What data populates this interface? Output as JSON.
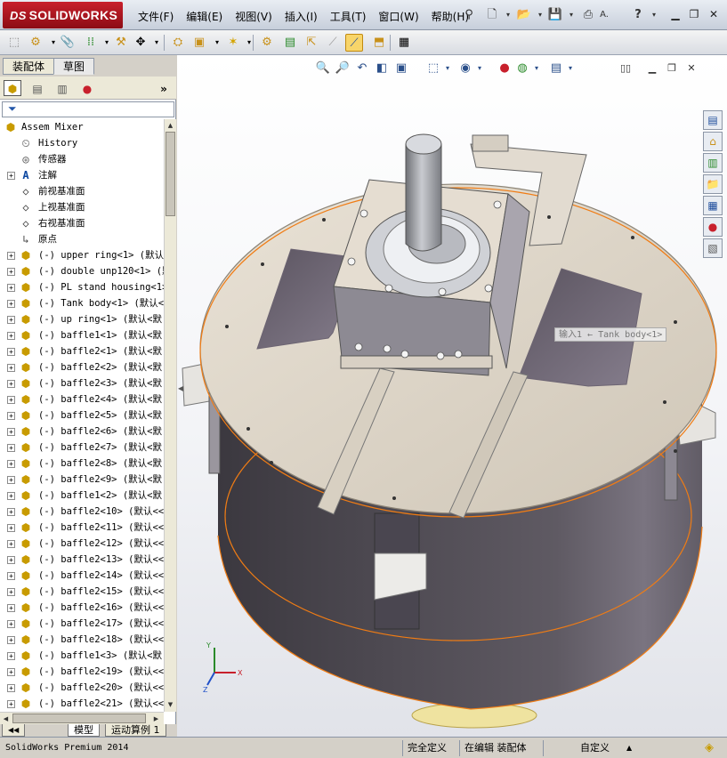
{
  "app": {
    "logo_prefix": "DS",
    "logo_text": "SOLIDWORKS"
  },
  "menu": [
    "文件(F)",
    "编辑(E)",
    "视图(V)",
    "插入(I)",
    "工具(T)",
    "窗口(W)",
    "帮助(H)"
  ],
  "title_extra": {
    "letters": "A.",
    "help": "?"
  },
  "panel": {
    "tabs": [
      "装配体",
      "草图"
    ],
    "active_tab": "装配体",
    "collapse_label": "»"
  },
  "tree": {
    "root": "Assem Mixer",
    "items": [
      {
        "label": "History",
        "icon": "history-icon",
        "type": "feature"
      },
      {
        "label": "传感器",
        "icon": "sensor-icon",
        "type": "feature"
      },
      {
        "label": "注解",
        "icon": "annotation-icon",
        "type": "feature",
        "expandable": true
      },
      {
        "label": "前视基准面",
        "icon": "plane-icon",
        "type": "plane"
      },
      {
        "label": "上视基准面",
        "icon": "plane-icon",
        "type": "plane"
      },
      {
        "label": "右视基准面",
        "icon": "plane-icon",
        "type": "plane"
      },
      {
        "label": "原点",
        "icon": "origin-icon",
        "type": "origin"
      },
      {
        "label": "(-) upper ring<1> (默认",
        "icon": "part-icon",
        "type": "part",
        "expandable": true
      },
      {
        "label": "(-) double unp120<1> (默",
        "icon": "part-icon",
        "type": "part",
        "expandable": true
      },
      {
        "label": "(-) PL stand housing<1>",
        "icon": "part-icon",
        "type": "part",
        "expandable": true
      },
      {
        "label": "(-) Tank body<1> (默认<",
        "icon": "part-icon",
        "type": "part",
        "expandable": true
      },
      {
        "label": "(-) up ring<1> (默认<默",
        "icon": "part-icon",
        "type": "part",
        "expandable": true
      },
      {
        "label": "(-) baffle1<1> (默认<默",
        "icon": "part-icon",
        "type": "part",
        "expandable": true
      },
      {
        "label": "(-) baffle2<1> (默认<默",
        "icon": "part-icon",
        "type": "part",
        "expandable": true
      },
      {
        "label": "(-) baffle2<2> (默认<默",
        "icon": "part-icon",
        "type": "part",
        "expandable": true
      },
      {
        "label": "(-) baffle2<3> (默认<默",
        "icon": "part-icon",
        "type": "part",
        "expandable": true
      },
      {
        "label": "(-) baffle2<4> (默认<默",
        "icon": "part-icon",
        "type": "part",
        "expandable": true
      },
      {
        "label": "(-) baffle2<5> (默认<默",
        "icon": "part-icon",
        "type": "part",
        "expandable": true
      },
      {
        "label": "(-) baffle2<6> (默认<默",
        "icon": "part-icon",
        "type": "part",
        "expandable": true
      },
      {
        "label": "(-) baffle2<7> (默认<默",
        "icon": "part-icon",
        "type": "part",
        "expandable": true
      },
      {
        "label": "(-) baffle2<8> (默认<默",
        "icon": "part-icon",
        "type": "part",
        "expandable": true
      },
      {
        "label": "(-) baffle2<9> (默认<默",
        "icon": "part-icon",
        "type": "part",
        "expandable": true
      },
      {
        "label": "(-) baffle1<2> (默认<默",
        "icon": "part-icon",
        "type": "part",
        "expandable": true
      },
      {
        "label": "(-) baffle2<10> (默认<<",
        "icon": "part-icon",
        "type": "part",
        "expandable": true
      },
      {
        "label": "(-) baffle2<11> (默认<<",
        "icon": "part-icon",
        "type": "part",
        "expandable": true
      },
      {
        "label": "(-) baffle2<12> (默认<<",
        "icon": "part-icon",
        "type": "part",
        "expandable": true
      },
      {
        "label": "(-) baffle2<13> (默认<<",
        "icon": "part-icon",
        "type": "part",
        "expandable": true
      },
      {
        "label": "(-) baffle2<14> (默认<<",
        "icon": "part-icon",
        "type": "part",
        "expandable": true
      },
      {
        "label": "(-) baffle2<15> (默认<<",
        "icon": "part-icon",
        "type": "part",
        "expandable": true
      },
      {
        "label": "(-) baffle2<16> (默认<<",
        "icon": "part-icon",
        "type": "part",
        "expandable": true
      },
      {
        "label": "(-) baffle2<17> (默认<<",
        "icon": "part-icon",
        "type": "part",
        "expandable": true
      },
      {
        "label": "(-) baffle2<18> (默认<<",
        "icon": "part-icon",
        "type": "part",
        "expandable": true
      },
      {
        "label": "(-) baffle1<3> (默认<默",
        "icon": "part-icon",
        "type": "part",
        "expandable": true
      },
      {
        "label": "(-) baffle2<19> (默认<<",
        "icon": "part-icon",
        "type": "part",
        "expandable": true
      },
      {
        "label": "(-) baffle2<20> (默认<<",
        "icon": "part-icon",
        "type": "part",
        "expandable": true
      },
      {
        "label": "(-) baffle2<21> (默认<<",
        "icon": "part-icon",
        "type": "part",
        "expandable": true
      }
    ]
  },
  "bottom_tabs": [
    "模型",
    "运动算例 1"
  ],
  "viewport": {
    "tooltip": "输入1 ← Tank body<1>",
    "triad": {
      "x": "X",
      "y": "Y",
      "z": "Z"
    },
    "colors": {
      "tank": "#5f5a63",
      "plate": "#dcd3c5",
      "highlight": "#f07c14",
      "shaft": "#8c8e94"
    }
  },
  "status": {
    "product": "SolidWorks Premium 2014",
    "definition": "完全定义",
    "mode": "在编辑 装配体",
    "units": "自定义",
    "units_arrow": "▲"
  }
}
